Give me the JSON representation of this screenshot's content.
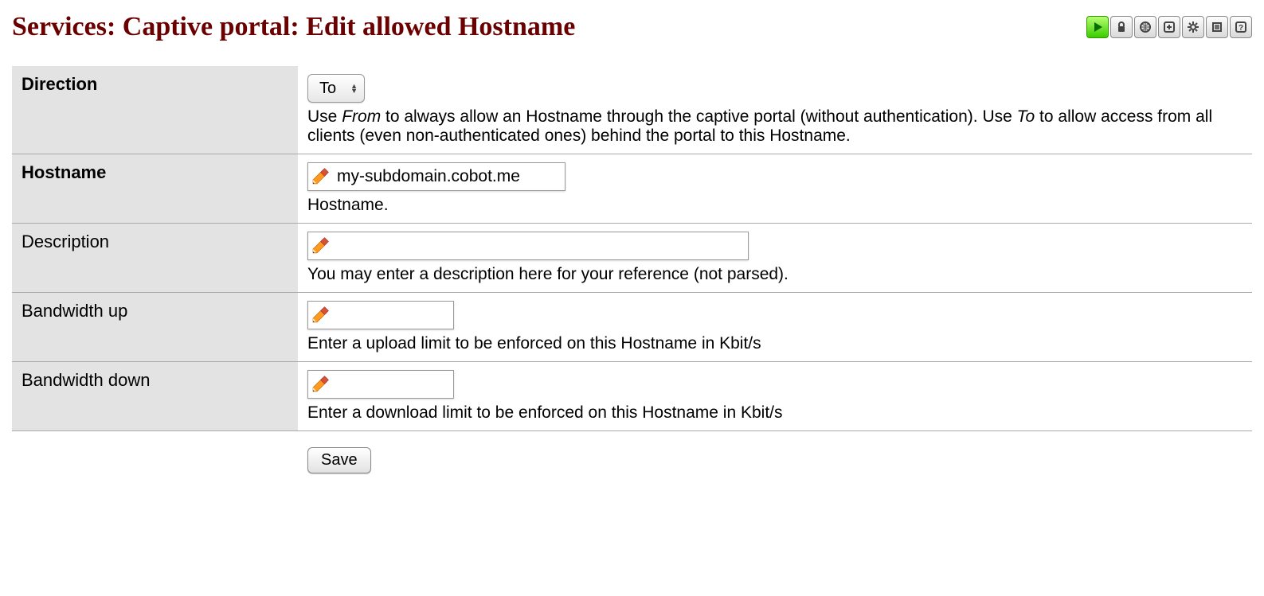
{
  "page": {
    "title": "Services: Captive portal: Edit allowed Hostname"
  },
  "toolbar_icons": [
    "play",
    "lock",
    "globe",
    "add",
    "gear",
    "list",
    "help"
  ],
  "fields": {
    "direction": {
      "label": "Direction",
      "selected": "To",
      "help_pre": "Use ",
      "help_em1": "From",
      "help_mid": " to always allow an Hostname through the captive portal (without authentication). Use ",
      "help_em2": "To",
      "help_post": " to allow access from all clients (even non-authenticated ones) behind the portal to this Hostname."
    },
    "hostname": {
      "label": "Hostname",
      "value": "my-subdomain.cobot.me",
      "help": "Hostname."
    },
    "description": {
      "label": "Description",
      "value": "",
      "help": "You may enter a description here for your reference (not parsed)."
    },
    "bandwidth_up": {
      "label": "Bandwidth up",
      "value": "",
      "help": "Enter a upload limit to be enforced on this Hostname in Kbit/s"
    },
    "bandwidth_down": {
      "label": "Bandwidth down",
      "value": "",
      "help": "Enter a download limit to be enforced on this Hostname in Kbit/s"
    }
  },
  "buttons": {
    "save": "Save"
  }
}
